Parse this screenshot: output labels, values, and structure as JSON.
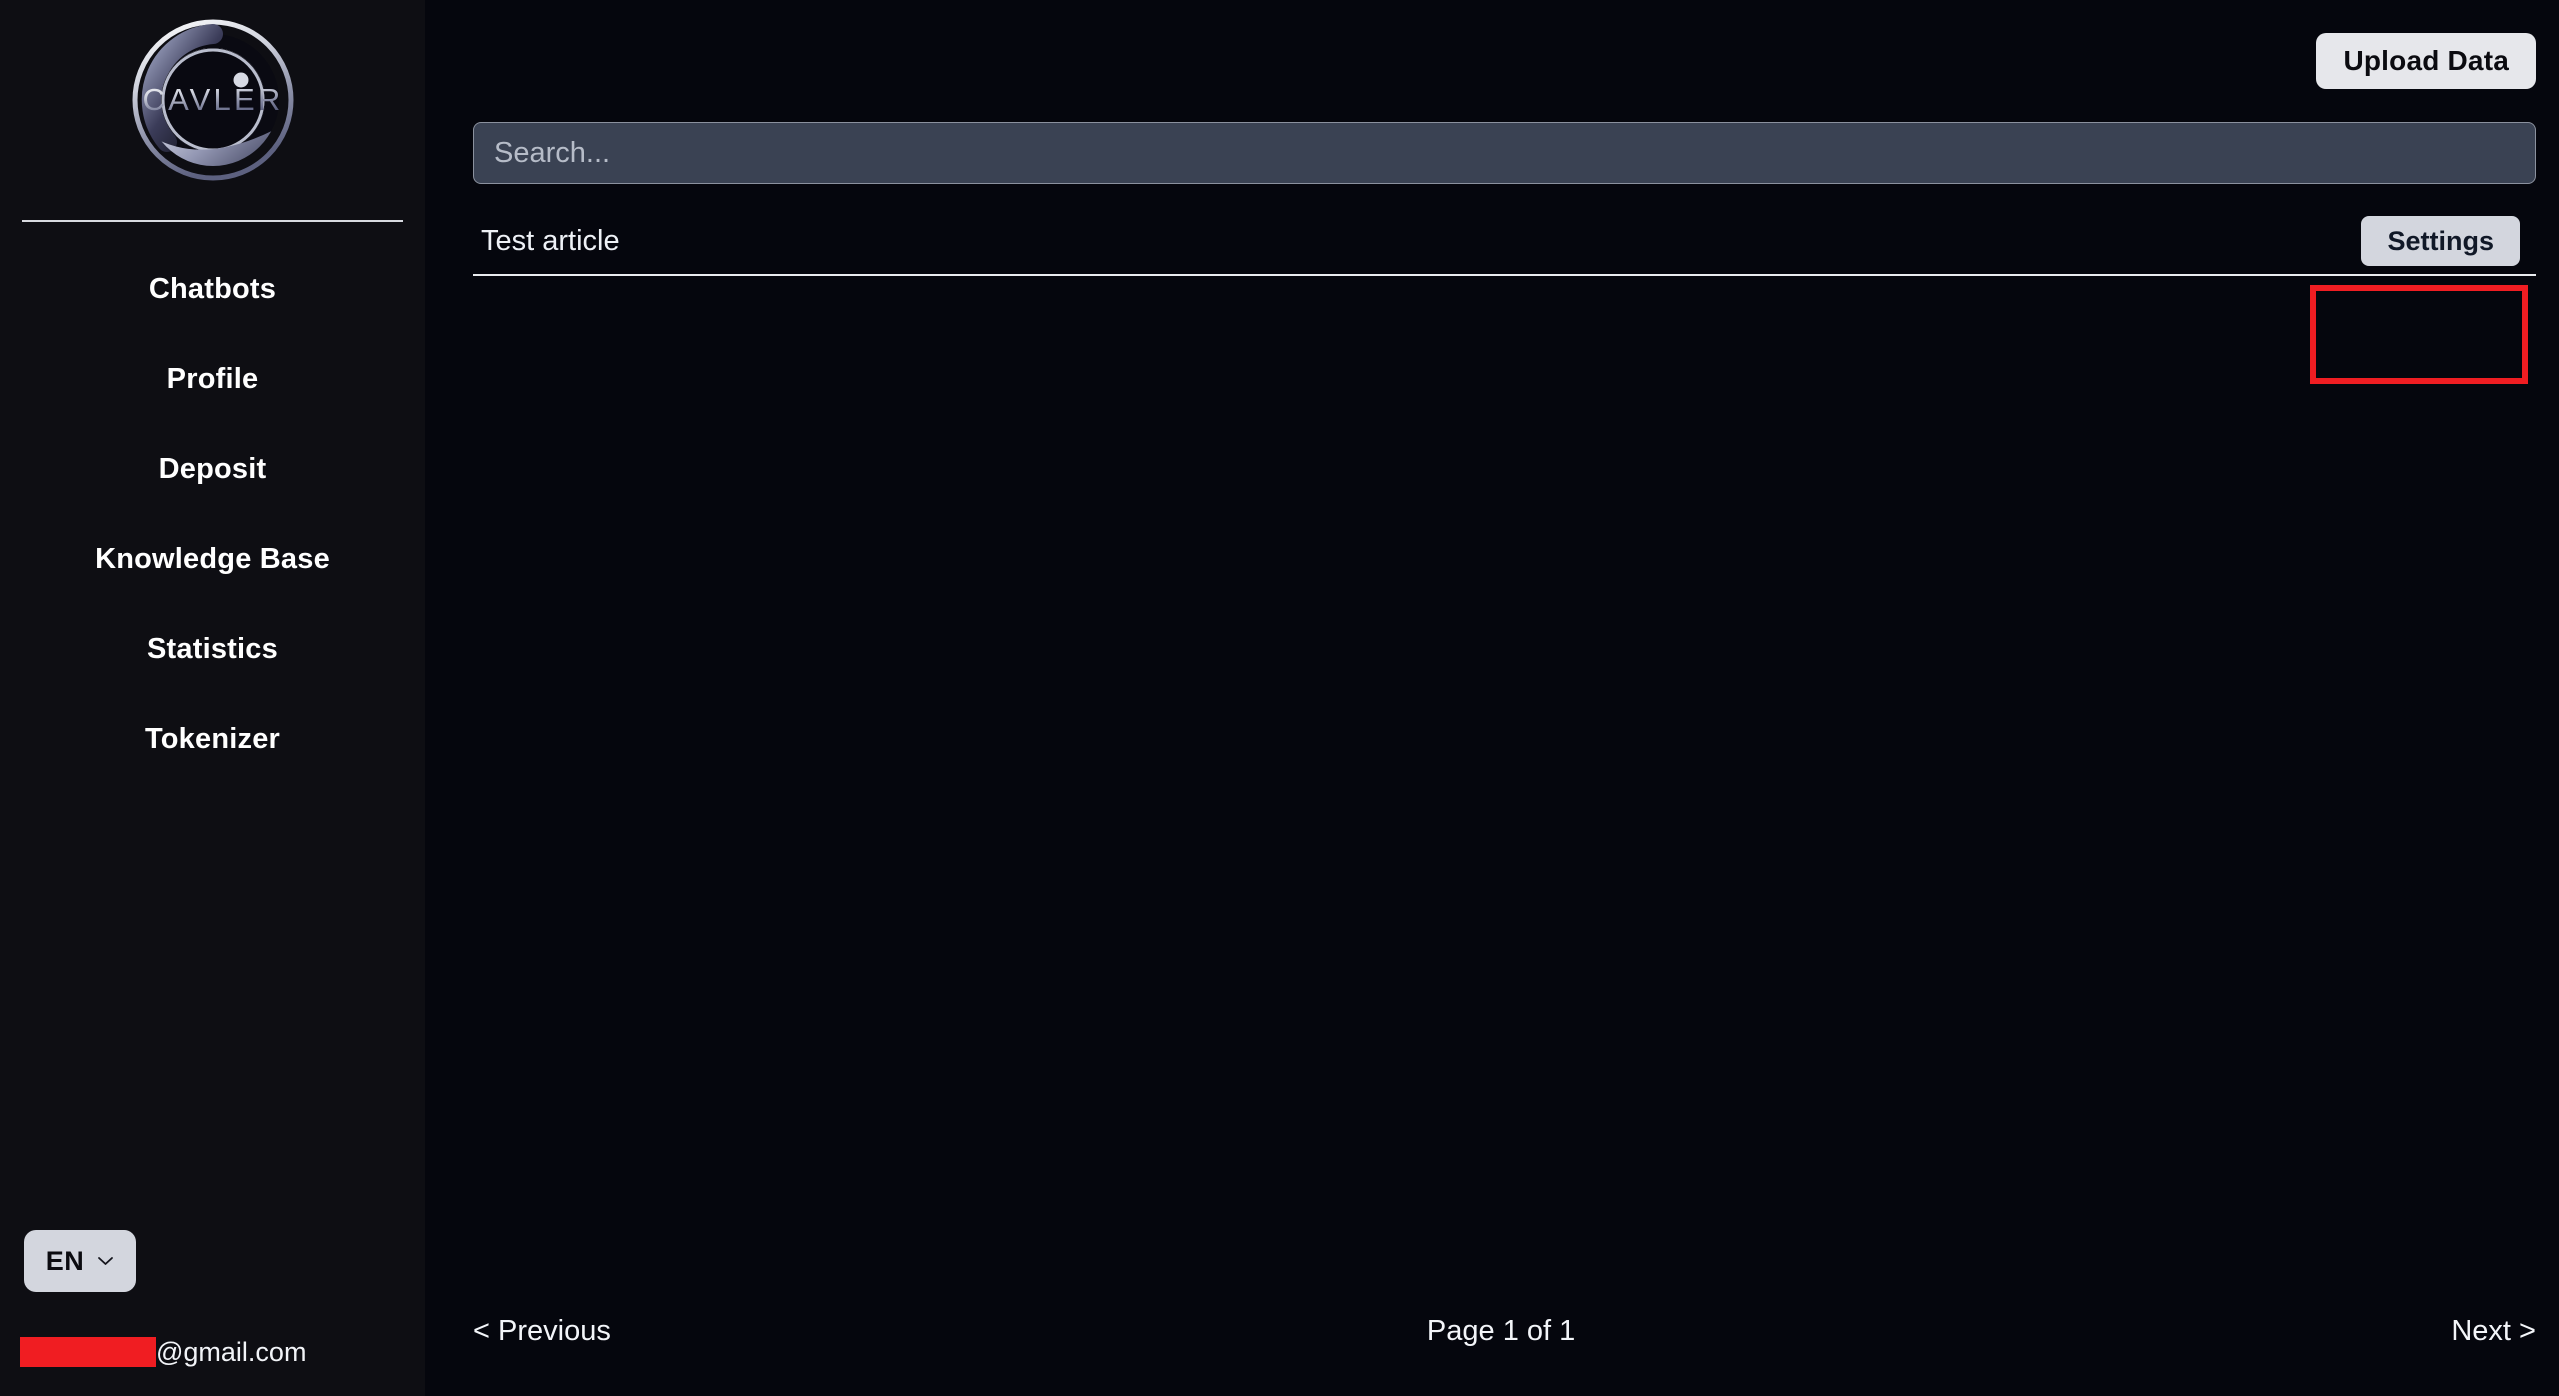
{
  "brand": {
    "name": "CAVLER",
    "logo_icon": "cavler-circular-emblem-logo"
  },
  "sidebar": {
    "items": [
      {
        "label": "Chatbots",
        "name": "chatbots"
      },
      {
        "label": "Profile",
        "name": "profile"
      },
      {
        "label": "Deposit",
        "name": "deposit"
      },
      {
        "label": "Knowledge Base",
        "name": "knowledge-base"
      },
      {
        "label": "Statistics",
        "name": "statistics"
      },
      {
        "label": "Tokenizer",
        "name": "tokenizer"
      }
    ],
    "language": {
      "value": "EN",
      "chevron_icon": "chevron-down-icon"
    },
    "account": {
      "redacted": true,
      "domain": "@gmail.com"
    }
  },
  "topbar": {
    "upload_label": "Upload Data"
  },
  "search": {
    "value": "",
    "placeholder": "Search..."
  },
  "list": {
    "rows": [
      {
        "title": "Test article",
        "action_label": "Settings",
        "highlighted": true
      }
    ]
  },
  "pagination": {
    "previous_label": "< Previous",
    "page_indicator": "Page 1 of 1",
    "next_label": "Next >"
  },
  "colors": {
    "app_background": "#05060d",
    "sidebar_background": "#0e0e13",
    "button_light": "#d3d6de",
    "button_upload": "#e6e7eb",
    "search_field": "#3a4253",
    "text_primary": "#ffffff",
    "highlight_red": "#f01d22",
    "divider": "#e9ebee"
  }
}
